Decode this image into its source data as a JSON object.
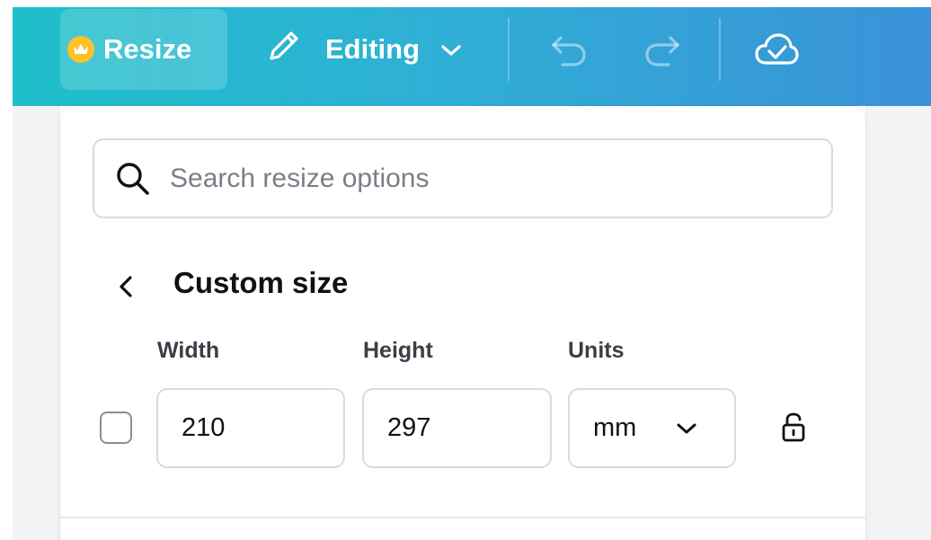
{
  "toolbar": {
    "resize_label": "Resize",
    "editing_label": "Editing",
    "icons": {
      "crown": "crown-icon",
      "pencil": "pencil-icon",
      "chevron": "chevron-down-icon",
      "undo": "undo-icon",
      "redo": "redo-icon",
      "cloud": "cloud-check-icon"
    },
    "colors": {
      "gradient_start": "#1ebfc9",
      "gradient_end": "#3a92d8",
      "crown_badge": "#ffc229"
    }
  },
  "panel": {
    "search": {
      "placeholder": "Search resize options",
      "value": ""
    },
    "section_title": "Custom size",
    "fields": {
      "width": {
        "label": "Width",
        "value": "210"
      },
      "height": {
        "label": "Height",
        "value": "297"
      },
      "units": {
        "label": "Units",
        "value": "mm"
      }
    },
    "lock_icon": "unlock-icon"
  }
}
